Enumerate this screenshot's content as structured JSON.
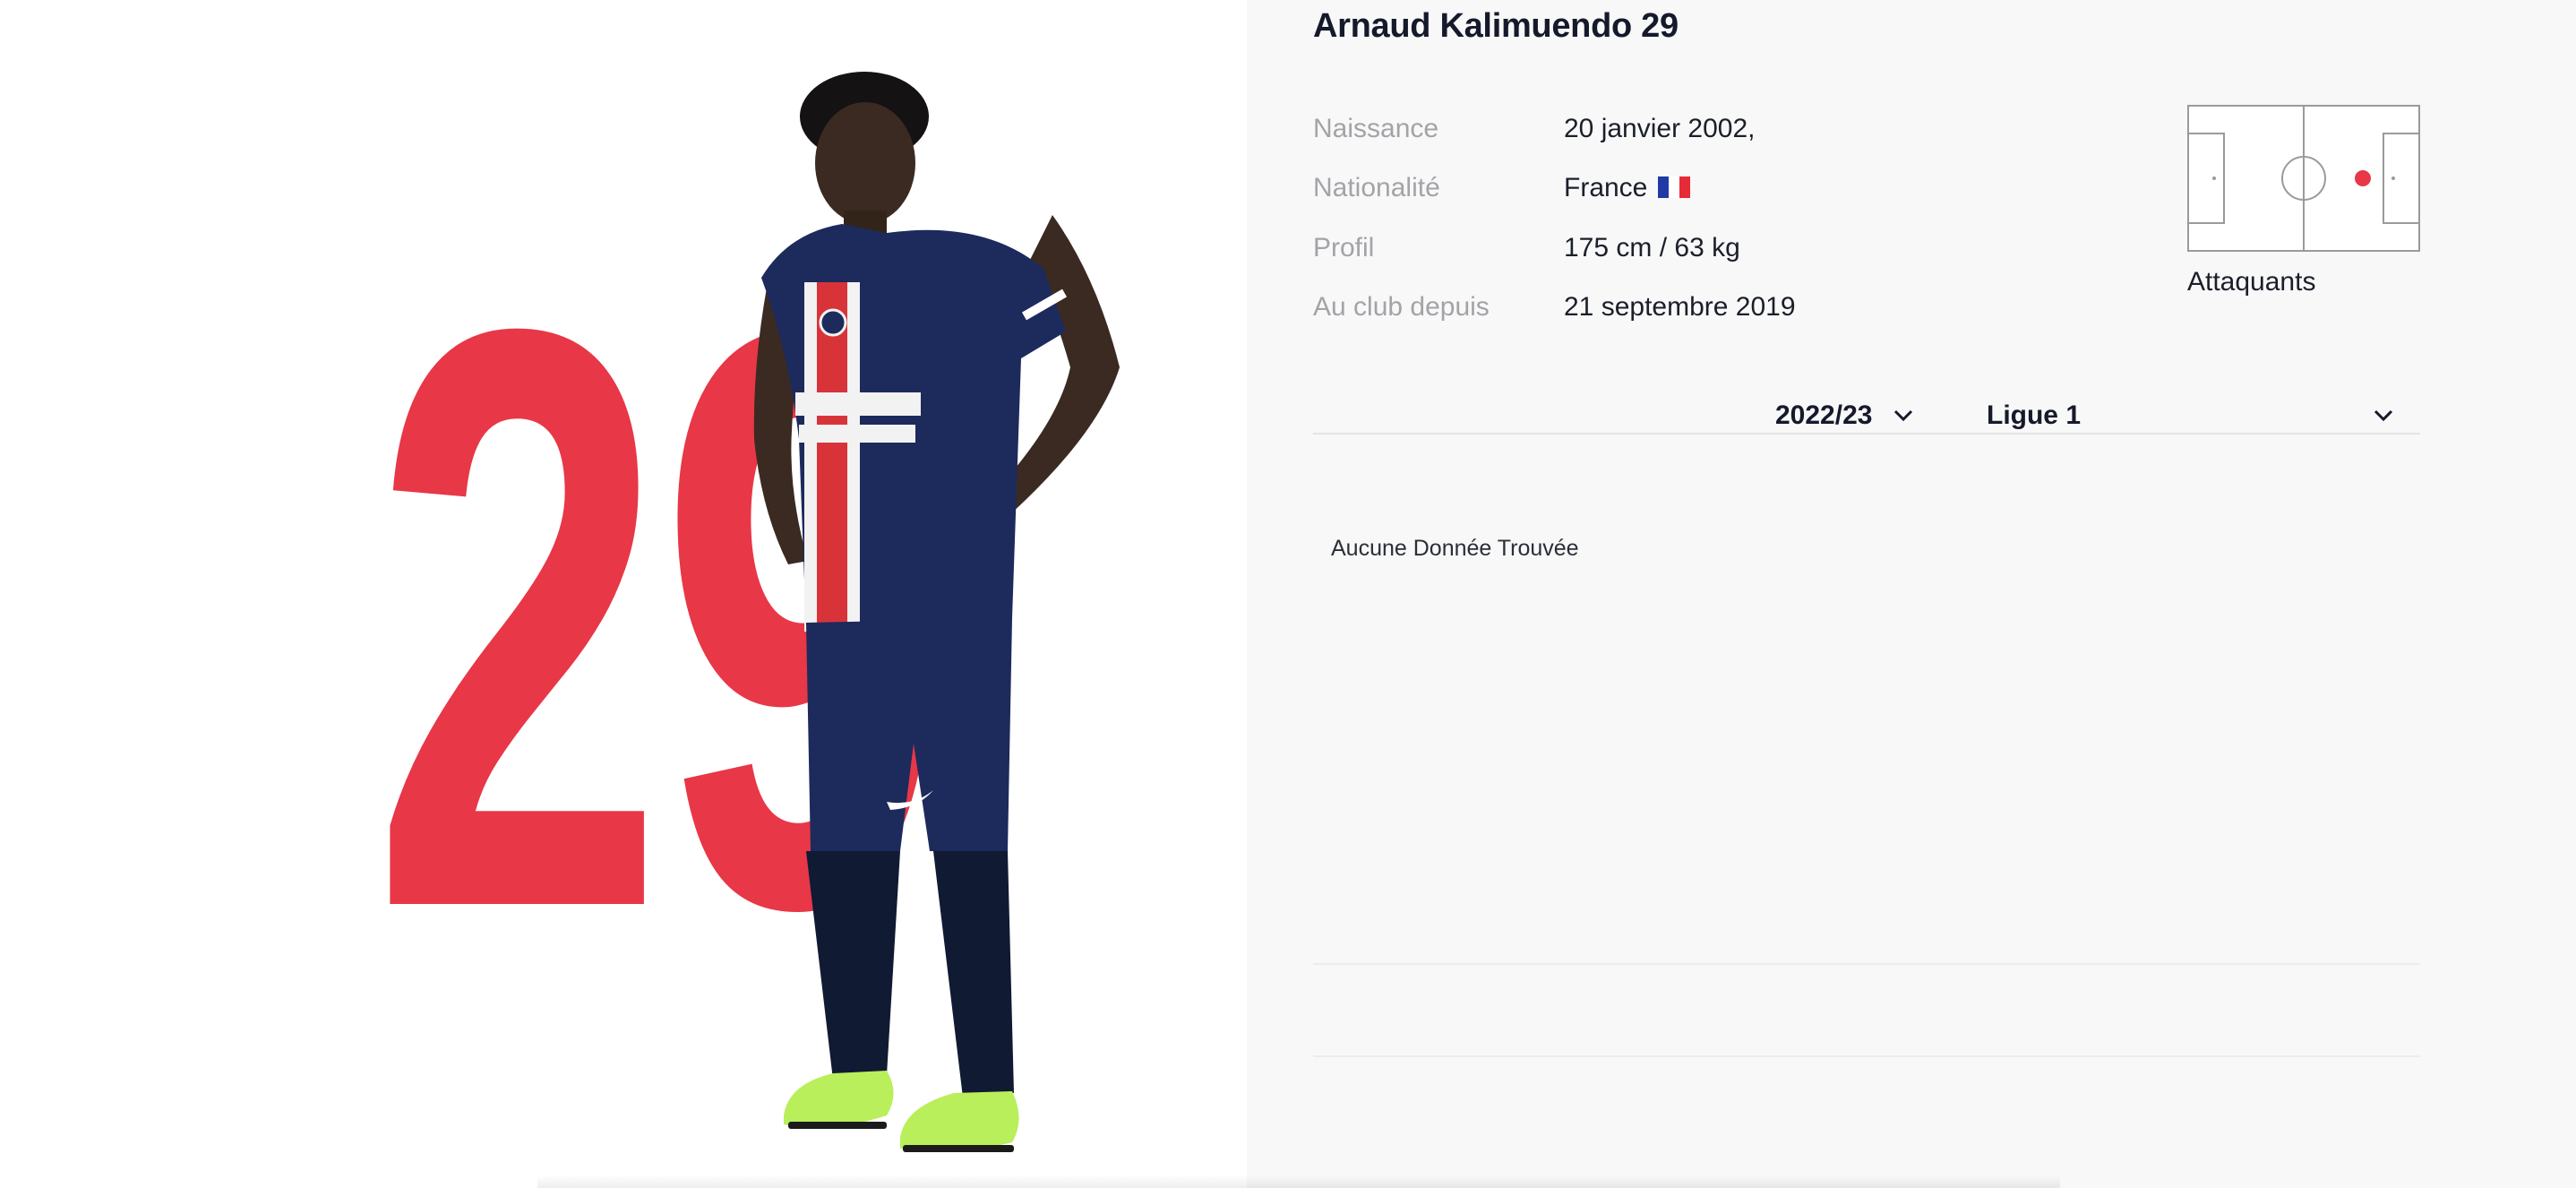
{
  "player": {
    "name": "Arnaud Kalimuendo 29",
    "shirt_number": "29",
    "image_alt": "player-photo-icon"
  },
  "info": [
    {
      "label": "Naissance",
      "value": "20 janvier 2002,"
    },
    {
      "label": "Nationalité",
      "value": "France"
    },
    {
      "label": "Profil",
      "value": "175 cm / 63 kg"
    },
    {
      "label": "Au club depuis",
      "value": "21 septembre 2019"
    }
  ],
  "position": {
    "label": "Attaquants"
  },
  "filters": {
    "season": "2022/23",
    "competition": "Ligue 1"
  },
  "stats": {
    "empty_message": "Aucune Donnée Trouvée"
  },
  "colors": {
    "accent_red": "#e83747",
    "kit_navy": "#1d2a5c",
    "boot_green": "#b9ef5a",
    "flag": [
      "#1f3aa6",
      "#ffffff",
      "#e62b37"
    ]
  }
}
